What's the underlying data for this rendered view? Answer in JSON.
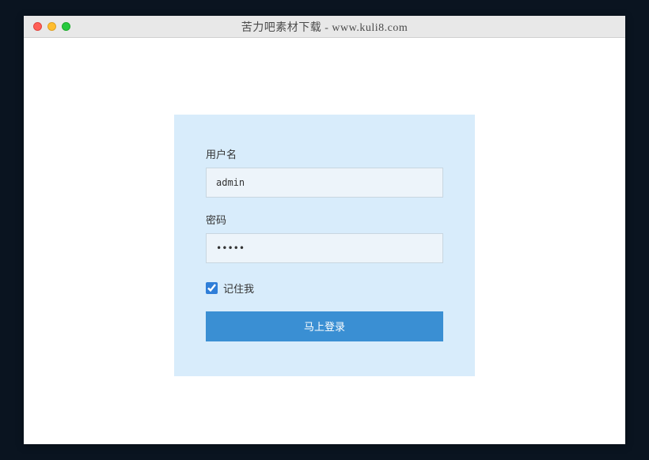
{
  "window": {
    "title": "苦力吧素材下载 - www.kuli8.com"
  },
  "login": {
    "username_label": "用户名",
    "username_value": "admin",
    "password_label": "密码",
    "password_value": "•••••",
    "remember_label": "记住我",
    "remember_checked": true,
    "submit_label": "马上登录"
  }
}
